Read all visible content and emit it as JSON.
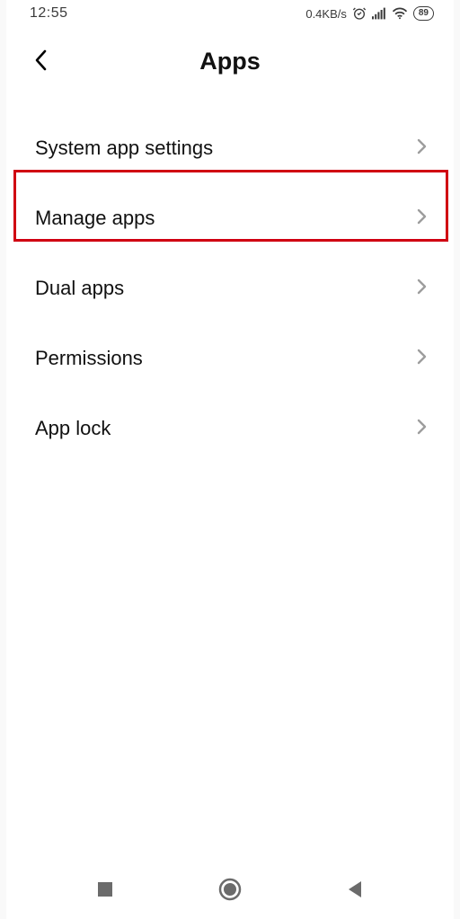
{
  "status": {
    "time": "12:55",
    "net_speed": "0.4KB/s",
    "battery": "89"
  },
  "header": {
    "title": "Apps"
  },
  "list": {
    "items": [
      {
        "label": "System app settings"
      },
      {
        "label": "Manage apps"
      },
      {
        "label": "Dual apps"
      },
      {
        "label": "Permissions"
      },
      {
        "label": "App lock"
      }
    ]
  },
  "highlight_index": 1
}
